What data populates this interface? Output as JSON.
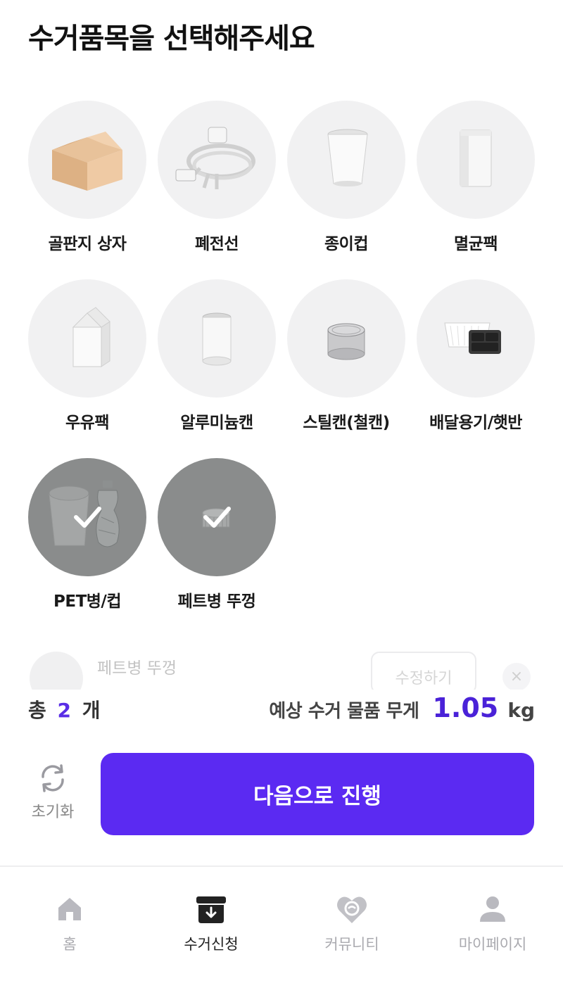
{
  "header": {
    "title": "수거품목을 선택해주세요"
  },
  "items": [
    {
      "label": "골판지 상자",
      "icon": "cardboard-box-icon",
      "selected": false
    },
    {
      "label": "폐전선",
      "icon": "cable-icon",
      "selected": false
    },
    {
      "label": "종이컵",
      "icon": "paper-cup-icon",
      "selected": false
    },
    {
      "label": "멸균팩",
      "icon": "sterile-pack-icon",
      "selected": false
    },
    {
      "label": "우유팩",
      "icon": "milk-carton-icon",
      "selected": false
    },
    {
      "label": "알루미늄캔",
      "icon": "aluminum-can-icon",
      "selected": false
    },
    {
      "label": "스틸캔(철캔)",
      "icon": "steel-can-icon",
      "selected": false
    },
    {
      "label": "배달용기/햇반",
      "icon": "delivery-container-icon",
      "selected": false
    },
    {
      "label": "PET병/컵",
      "icon": "pet-bottle-icon",
      "selected": true
    },
    {
      "label": "페트병 뚜껑",
      "icon": "bottle-cap-icon",
      "selected": true
    }
  ],
  "selected_list": {
    "name": "페트병 뚜껑",
    "edit_label": "수정하기",
    "remove_label": "×"
  },
  "summary": {
    "total_prefix": "총",
    "count": "2",
    "count_unit": "개",
    "weight_label": "예상 수거 물품 무게",
    "weight": "1.05",
    "weight_unit": "kg"
  },
  "actions": {
    "reset_label": "초기화",
    "next_label": "다음으로 진행"
  },
  "tabbar": [
    {
      "label": "홈",
      "icon": "home-icon",
      "active": false
    },
    {
      "label": "수거신청",
      "icon": "pickup-box-icon",
      "active": true
    },
    {
      "label": "커뮤니티",
      "icon": "heart-community-icon",
      "active": false
    },
    {
      "label": "마이페이지",
      "icon": "user-icon",
      "active": false
    }
  ],
  "colors": {
    "accent": "#5b2af2",
    "weight": "#4a22d8",
    "selected_overlay": "#8a8c8c"
  }
}
